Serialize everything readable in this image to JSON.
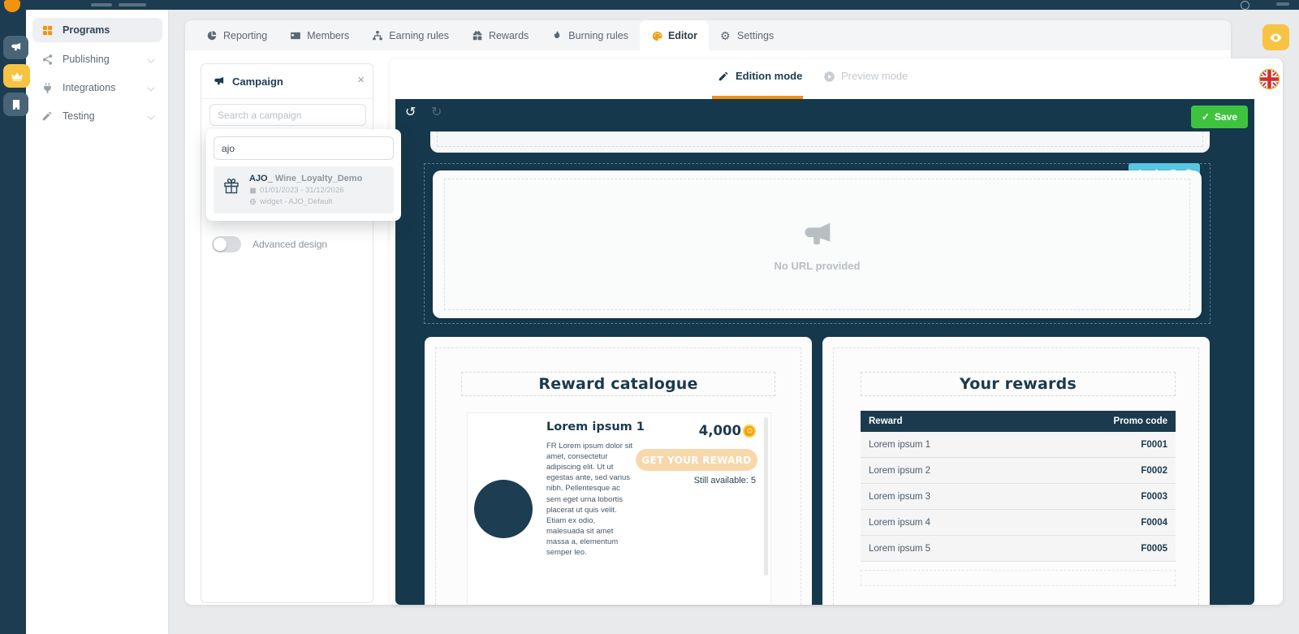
{
  "sidebar": {
    "items": [
      {
        "label": "Programs"
      },
      {
        "label": "Publishing"
      },
      {
        "label": "Integrations"
      },
      {
        "label": "Testing"
      }
    ]
  },
  "nav_tabs": {
    "items": [
      {
        "label": "Reporting"
      },
      {
        "label": "Members"
      },
      {
        "label": "Earning rules"
      },
      {
        "label": "Rewards"
      },
      {
        "label": "Burning rules"
      },
      {
        "label": "Editor"
      },
      {
        "label": "Settings"
      }
    ]
  },
  "campaign_panel": {
    "title": "Campaign",
    "search_placeholder": "Search a campaign",
    "dropdown": {
      "query": "ajo",
      "result": {
        "name_prefix": "AJO_",
        "name": "Wine_Loyalty_Demo",
        "date_range": "01/01/2023 - 31/12/2026",
        "target": "widget - AJO_Default"
      }
    },
    "advanced_design_label": "Advanced design"
  },
  "editor": {
    "edition_mode_label": "Edition mode",
    "preview_mode_label": "Preview mode",
    "save_label": "Save"
  },
  "widget": {
    "embed": {
      "message": "No URL provided"
    },
    "catalogue": {
      "title": "Reward catalogue",
      "item": {
        "name": "Lorem ipsum 1",
        "description": "FR Lorem ipsum dolor sit amet, consectetur adipiscing elit. Ut ut egestas ante, sed varius nibh. Pellentesque ac sem eget urna lobortis placerat ut quis velit. Etiam ex odio, malesuada sit amet massa a, elementum semper leo.",
        "points": "4,000",
        "cta": "GET YOUR REWARD",
        "availability": "Still available: 5"
      }
    },
    "rewards": {
      "title": "Your rewards",
      "columns": {
        "reward": "Reward",
        "promo": "Promo code"
      },
      "rows": [
        {
          "name": "Lorem ipsum 1",
          "code": "F0001"
        },
        {
          "name": "Lorem ipsum 2",
          "code": "F0002"
        },
        {
          "name": "Lorem ipsum 3",
          "code": "F0003"
        },
        {
          "name": "Lorem ipsum 4",
          "code": "F0004"
        },
        {
          "name": "Lorem ipsum 5",
          "code": "F0005"
        }
      ]
    }
  },
  "glyphs": {
    "undo": "↺",
    "redo": "↻",
    "check": "✓",
    "close": "×",
    "gear": "⚙"
  },
  "colors": {
    "navy": "#1b3a4e",
    "canvas": "#16384c",
    "yellow": "#f6c343",
    "orange": "#f09111",
    "green": "#3fc33f",
    "light_blue": "#58c7e4",
    "peach": "#f8d7ab"
  }
}
